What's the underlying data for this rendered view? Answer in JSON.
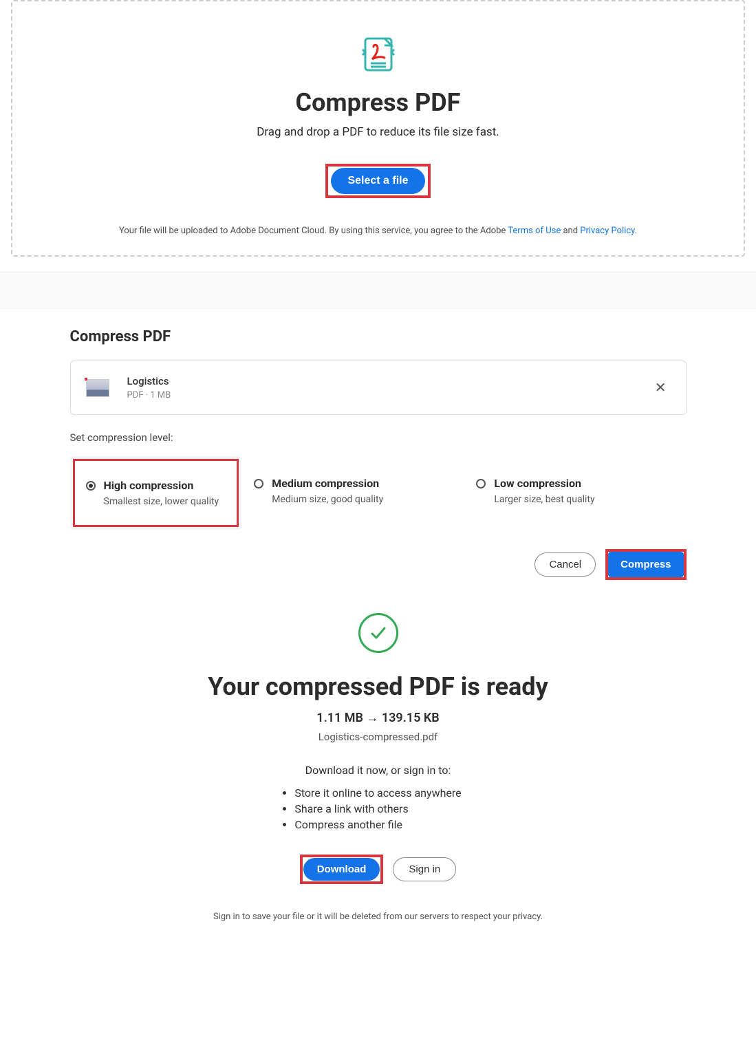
{
  "dropzone": {
    "title": "Compress PDF",
    "subtitle": "Drag and drop a PDF to reduce its file size fast.",
    "select_button": "Select a file",
    "legal_prefix": "Your file will be uploaded to Adobe Document Cloud.   By using this service, you agree to the Adobe ",
    "terms_link": "Terms of Use",
    "legal_mid": " and ",
    "privacy_link": "Privacy Policy."
  },
  "panel": {
    "title": "Compress PDF",
    "file": {
      "name": "Logistics",
      "meta": "PDF · 1 MB"
    },
    "set_label": "Set compression level:",
    "options": [
      {
        "title": "High compression",
        "sub": "Smallest size, lower quality"
      },
      {
        "title": "Medium compression",
        "sub": "Medium size, good quality"
      },
      {
        "title": "Low compression",
        "sub": "Larger size, best quality"
      }
    ],
    "cancel": "Cancel",
    "compress": "Compress"
  },
  "ready": {
    "heading": "Your compressed PDF is ready",
    "size_line": "1.11 MB → 139.15 KB",
    "filename": "Logistics-compressed.pdf",
    "intro": "Download it now, or sign in to:",
    "bullets": [
      "Store it online to access anywhere",
      "Share a link with others",
      "Compress another file"
    ],
    "download": "Download",
    "signin": "Sign in",
    "privacy": "Sign in to save your file or it will be deleted from our servers to respect your privacy."
  }
}
